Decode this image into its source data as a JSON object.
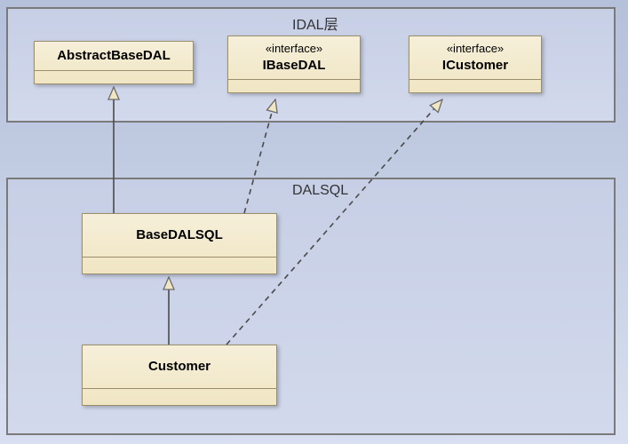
{
  "packages": {
    "idal": {
      "label": "IDAL层"
    },
    "dalsql": {
      "label": "DALSQL"
    }
  },
  "classes": {
    "abstractBaseDAL": {
      "stereotype": "",
      "name": "AbstractBaseDAL"
    },
    "ibaseDAL": {
      "stereotype": "«interface»",
      "name": "IBaseDAL"
    },
    "icustomer": {
      "stereotype": "«interface»",
      "name": "ICustomer"
    },
    "baseDALSQL": {
      "stereotype": "",
      "name": "BaseDALSQL"
    },
    "customer": {
      "stereotype": "",
      "name": "Customer"
    }
  },
  "relationships": [
    {
      "from": "BaseDALSQL",
      "to": "AbstractBaseDAL",
      "type": "generalization"
    },
    {
      "from": "BaseDALSQL",
      "to": "IBaseDAL",
      "type": "realization"
    },
    {
      "from": "Customer",
      "to": "BaseDALSQL",
      "type": "generalization"
    },
    {
      "from": "Customer",
      "to": "ICustomer",
      "type": "realization"
    }
  ]
}
